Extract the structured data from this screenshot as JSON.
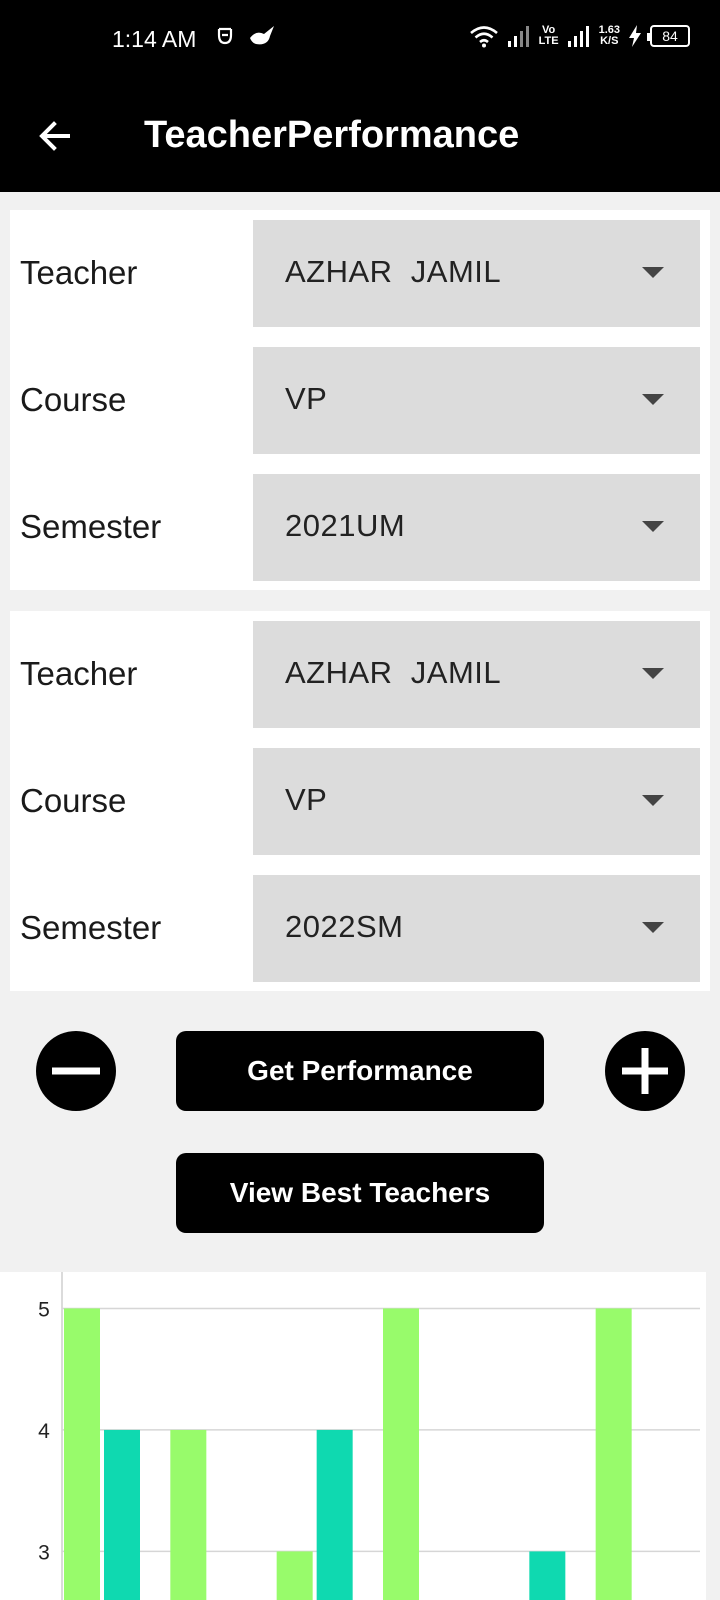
{
  "status_bar": {
    "time": "1:14 AM",
    "network_type": "Vo\nLTE",
    "speed_value": "1.63",
    "speed_unit": "K/S",
    "battery": "84",
    "icons": [
      "notification-app-icon",
      "notification-bird-icon",
      "wifi-icon",
      "signal-icon",
      "signal-icon",
      "charging-icon"
    ]
  },
  "app_bar": {
    "title": "TeacherPerformance",
    "back_icon": "arrow-left-icon"
  },
  "form_group_1": {
    "teacher_label": "Teacher",
    "teacher_value": "AZHAR  JAMIL",
    "course_label": "Course",
    "course_value": "VP",
    "semester_label": "Semester",
    "semester_value": "2021UM"
  },
  "form_group_2": {
    "teacher_label": "Teacher",
    "teacher_value": "AZHAR  JAMIL",
    "course_label": "Course",
    "course_value": "VP",
    "semester_label": "Semester",
    "semester_value": "2022SM"
  },
  "actions": {
    "remove_icon": "minus-icon",
    "add_icon": "plus-icon",
    "get_performance_label": "Get Performance",
    "view_best_teachers_label": "View Best Teachers"
  },
  "chart_data": {
    "type": "bar",
    "y_ticks": [
      "5",
      "4",
      "3"
    ],
    "visible_y_range": [
      2.6,
      5.3
    ],
    "grid": true,
    "colors": [
      "#98fb6b",
      "#0fd9b0"
    ],
    "series": [
      {
        "values": [
          5,
          4,
          3,
          5,
          null,
          5
        ]
      },
      {
        "values": [
          4,
          null,
          4,
          null,
          3,
          null
        ]
      }
    ]
  }
}
